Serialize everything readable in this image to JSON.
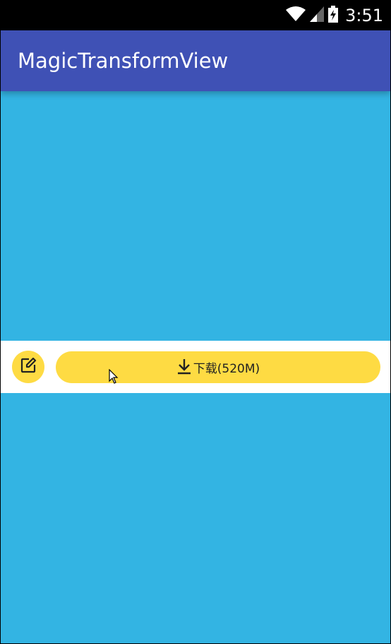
{
  "status_bar": {
    "time": "3:51",
    "icons": [
      "wifi-icon",
      "signal-icon",
      "battery-icon"
    ]
  },
  "app_bar": {
    "title": "MagicTransformView",
    "color": "#3f51b5"
  },
  "content": {
    "background_color": "#33b4e3"
  },
  "action_strip": {
    "edit_icon": "edit-icon",
    "download_icon": "download-icon",
    "download_label": "下载(520M)",
    "button_color": "#fedb43"
  }
}
